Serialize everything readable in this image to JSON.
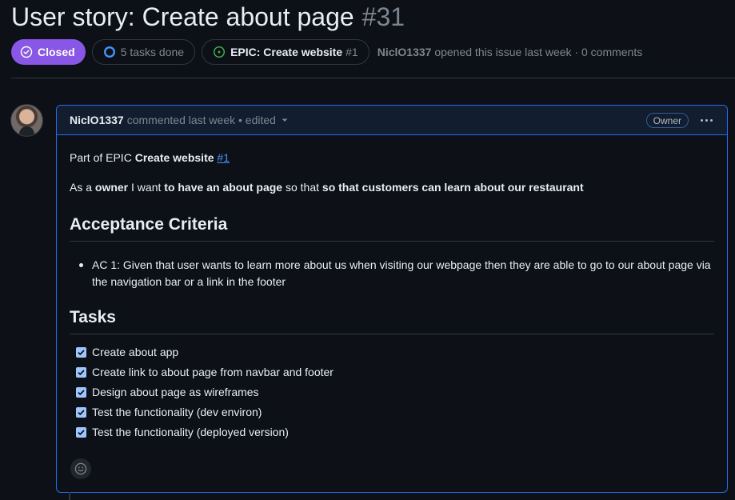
{
  "issue": {
    "title": "User story: Create about page",
    "number": "#31",
    "state_label": "Closed",
    "tasks_done": "5 tasks done",
    "epic_label": "EPIC: Create website",
    "epic_number": "#1",
    "opener_user": "NiclO1337",
    "opener_text": "opened this issue last week · 0 comments"
  },
  "comment": {
    "author": "NiclO1337",
    "meta": "commented last week • edited",
    "badge": "Owner",
    "part_of_prefix": "Part of EPIC",
    "part_of_epic": "Create website",
    "part_of_link": "#1",
    "story": {
      "t1": "As a ",
      "b1": "owner",
      "t2": " I want ",
      "b2": "to have an about page",
      "t3": " so that ",
      "b3": "so that customers can learn about our restaurant"
    },
    "acceptance_heading": "Acceptance Criteria",
    "criteria": [
      "AC 1: Given that user wants to learn more about us when visiting our webpage then they are able to go to our about page via the navigation bar or a link in the footer"
    ],
    "tasks_heading": "Tasks",
    "tasks": [
      {
        "label": "Create about app",
        "checked": true
      },
      {
        "label": "Create link to about page from navbar and footer",
        "checked": true
      },
      {
        "label": "Design about page as wireframes",
        "checked": true
      },
      {
        "label": "Test the functionality (dev environ)",
        "checked": true
      },
      {
        "label": "Test the functionality (deployed version)",
        "checked": true
      }
    ]
  },
  "colors": {
    "closed": "#8957e5",
    "link": "#4493f8",
    "focus_border": "#1f6feb"
  },
  "icons": [
    "check-circle-icon",
    "progress-circle-icon",
    "issue-open-icon",
    "caret-down-icon",
    "kebab-icon",
    "checkbox-icon",
    "smiley-icon"
  ]
}
